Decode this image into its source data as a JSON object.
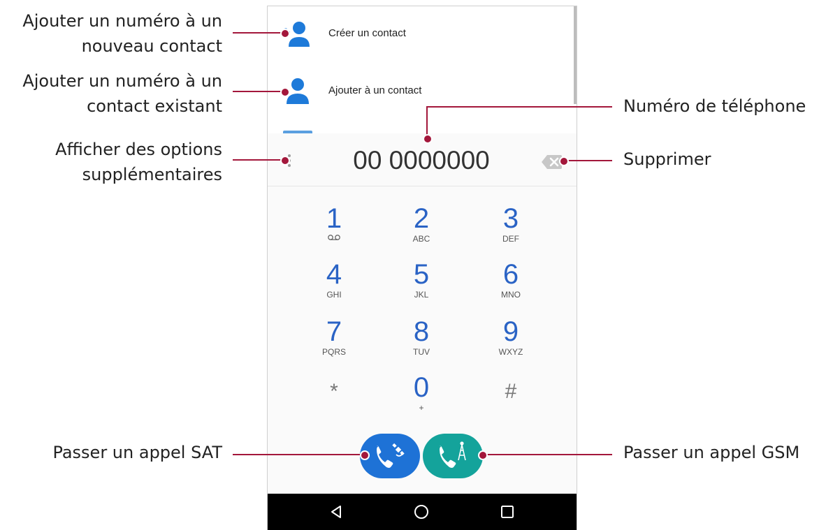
{
  "contacts": {
    "create_label": "Créer un contact",
    "add_label": "Ajouter à un contact"
  },
  "dialer": {
    "number": "00 0000000",
    "keys": [
      {
        "digit": "1",
        "letters": ""
      },
      {
        "digit": "2",
        "letters": "ABC"
      },
      {
        "digit": "3",
        "letters": "DEF"
      },
      {
        "digit": "4",
        "letters": "GHI"
      },
      {
        "digit": "5",
        "letters": "JKL"
      },
      {
        "digit": "6",
        "letters": "MNO"
      },
      {
        "digit": "7",
        "letters": "PQRS"
      },
      {
        "digit": "8",
        "letters": "TUV"
      },
      {
        "digit": "9",
        "letters": "WXYZ"
      },
      {
        "digit": "*",
        "letters": ""
      },
      {
        "digit": "0",
        "letters": "+"
      },
      {
        "digit": "#",
        "letters": ""
      }
    ],
    "sat_color": "#1e72d6",
    "gsm_color": "#14a39b"
  },
  "callouts": {
    "new_contact_1": "Ajouter un numéro à un",
    "new_contact_2": "nouveau contact",
    "existing_contact_1": "Ajouter un numéro à un",
    "existing_contact_2": "contact existant",
    "more_options_1": "Afficher des options",
    "more_options_2": "supplémentaires",
    "phone_number": "Numéro de téléphone",
    "delete": "Supprimer",
    "sat_call": "Passer un appel SAT",
    "gsm_call": "Passer un appel GSM"
  },
  "accent_color": "#a3173b"
}
